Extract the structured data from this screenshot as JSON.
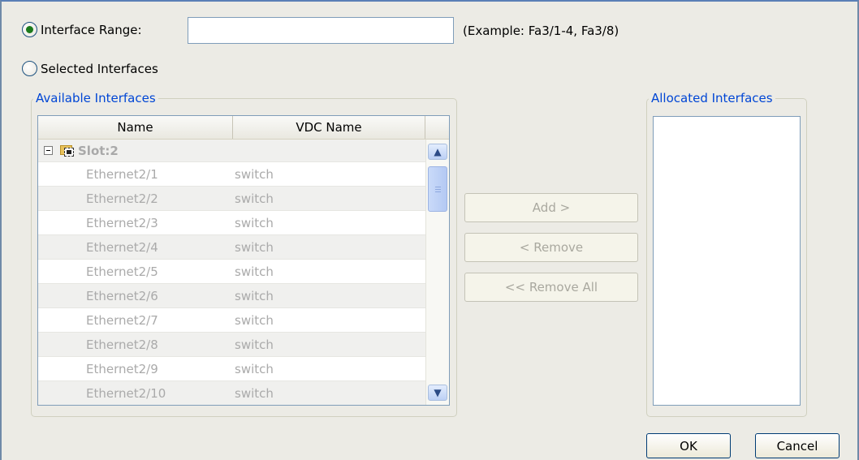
{
  "range_option": {
    "label": "Interface Range:",
    "selected": true,
    "input_value": "",
    "example": "(Example: Fa3/1-4, Fa3/8)"
  },
  "selected_option": {
    "label": "Selected Interfaces",
    "selected": false
  },
  "available": {
    "legend": "Available Interfaces",
    "columns": [
      "Name",
      "VDC Name"
    ],
    "slot_label": "Slot:2",
    "rows": [
      {
        "name": "Ethernet2/1",
        "vdc": "switch"
      },
      {
        "name": "Ethernet2/2",
        "vdc": "switch"
      },
      {
        "name": "Ethernet2/3",
        "vdc": "switch"
      },
      {
        "name": "Ethernet2/4",
        "vdc": "switch"
      },
      {
        "name": "Ethernet2/5",
        "vdc": "switch"
      },
      {
        "name": "Ethernet2/6",
        "vdc": "switch"
      },
      {
        "name": "Ethernet2/7",
        "vdc": "switch"
      },
      {
        "name": "Ethernet2/8",
        "vdc": "switch"
      },
      {
        "name": "Ethernet2/9",
        "vdc": "switch"
      },
      {
        "name": "Ethernet2/10",
        "vdc": "switch"
      }
    ]
  },
  "actions": {
    "add": "Add >",
    "remove": "< Remove",
    "remove_all": "<< Remove All"
  },
  "allocated": {
    "legend": "Allocated Interfaces"
  },
  "footer": {
    "ok": "OK",
    "cancel": "Cancel"
  },
  "colors": {
    "legend": "#0046d5",
    "disabled_text": "#aaaaaa",
    "dialog_bg": "#ecebe5",
    "radio_dot": "#1c7a1c"
  },
  "icons": {
    "collapse": "tree-collapse-icon",
    "slot": "slot-folder-icon",
    "scroll_up": "scroll-up-arrow-icon",
    "scroll_down": "scroll-down-arrow-icon"
  }
}
